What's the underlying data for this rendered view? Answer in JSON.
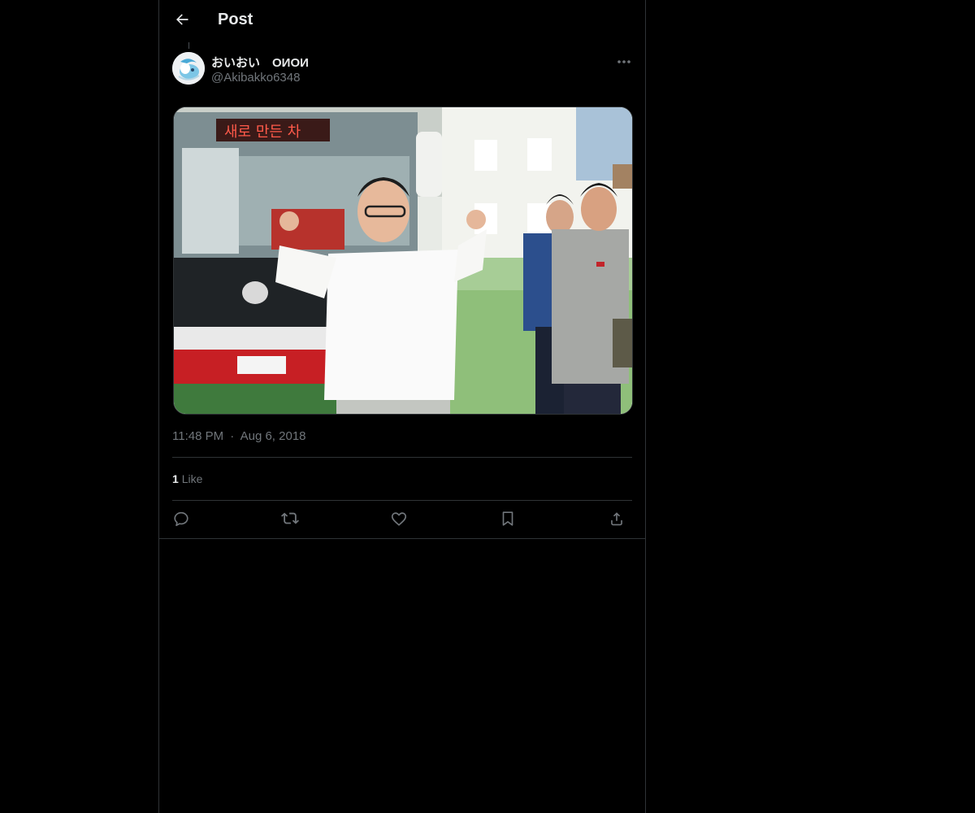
{
  "header": {
    "title": "Post",
    "back_icon": "arrow-left-icon"
  },
  "post": {
    "author": {
      "display_name": "おいおい　ОИОИ",
      "handle": "@Akibakko6348"
    },
    "media": {
      "sign_text": "새로 만든 차"
    },
    "time": "11:48 PM",
    "separator": "·",
    "date": "Aug 6, 2018",
    "likes": {
      "count": "1",
      "label": "Like"
    },
    "actions": [
      "reply-icon",
      "repost-icon",
      "like-icon",
      "bookmark-icon",
      "share-icon"
    ]
  },
  "colors": {
    "background": "#000000",
    "border": "#2f3336",
    "text": "#e7e9ea",
    "muted": "#71767b"
  }
}
